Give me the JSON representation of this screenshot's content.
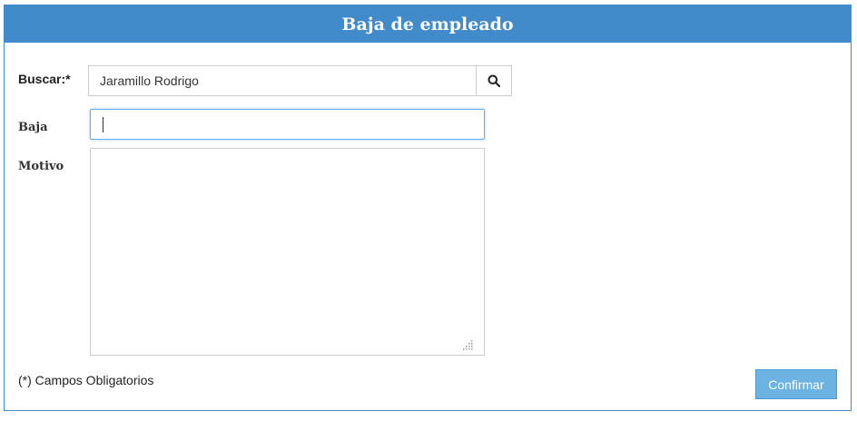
{
  "header": {
    "title": "Baja de empleado"
  },
  "form": {
    "search_label": "Buscar:*",
    "search_value": "Jaramillo Rodrigo",
    "baja_label": "Baja",
    "baja_value": "",
    "motivo_label": "Motivo",
    "motivo_value": "",
    "required_note": "(*) Campos Obligatorios",
    "confirm_label": "Confirmar"
  },
  "icons": {
    "search_button_icon": "search-icon",
    "textarea_grip_icon": "resize-grip-icon"
  },
  "colors": {
    "header_bg": "#428bca",
    "focus_border": "#66afe9",
    "confirm_bg": "#6cb3e2"
  }
}
